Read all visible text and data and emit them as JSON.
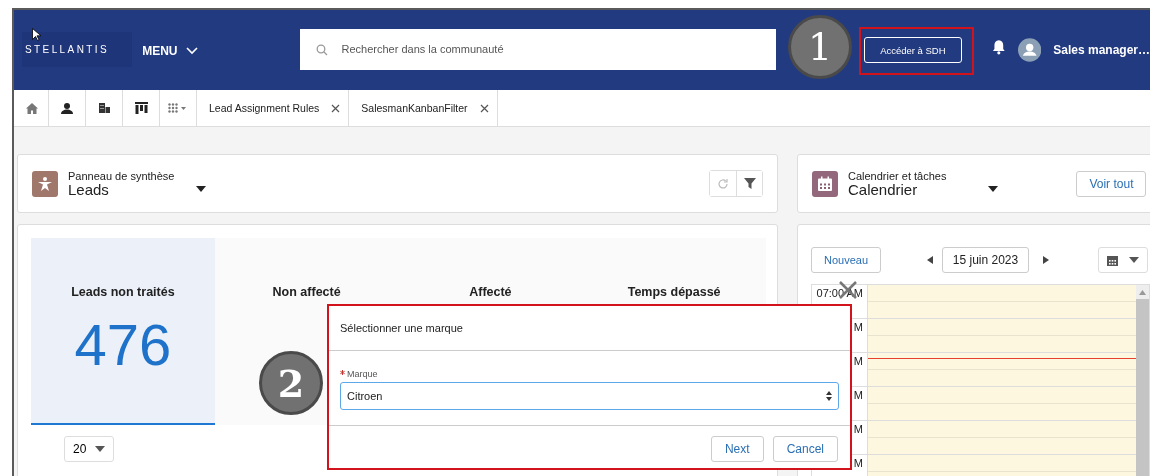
{
  "header": {
    "logo": "STELLANTIS",
    "menu": "MENU",
    "search": {
      "placeholder": "Rechercher dans la communauté"
    },
    "sdh_button": "Accéder à SDH",
    "user": "Sales manager…"
  },
  "nav_tabs": [
    {
      "label": "Lead Assignment Rules",
      "selected": false
    },
    {
      "label": "SalesmanKanbanFilter",
      "selected": false
    }
  ],
  "summary_card": {
    "subtitle": "Panneau de synthèse",
    "title": "Leads"
  },
  "stats": [
    {
      "label": "Leads non traités",
      "value": "476",
      "selected": true
    },
    {
      "label": "Non affecté",
      "selected": false
    },
    {
      "label": "Affecté",
      "selected": false
    },
    {
      "label": "Temps dépassé",
      "selected": false
    }
  ],
  "page_size": "20",
  "calendar_card": {
    "subtitle": "Calendrier et tâches",
    "title": "Calendrier",
    "view_all": "Voir tout"
  },
  "calendar": {
    "new_button": "Nouveau",
    "date": "15 juin 2023",
    "time_labels": [
      "07:00 AM",
      "M",
      "M",
      "M",
      "M",
      "M"
    ]
  },
  "modal": {
    "title": "Sélectionner une marque",
    "field": {
      "label": "Marque",
      "required": true,
      "value": "Citroen"
    },
    "buttons": [
      "Next",
      "Cancel"
    ]
  },
  "annotations": [
    "1",
    "2"
  ]
}
